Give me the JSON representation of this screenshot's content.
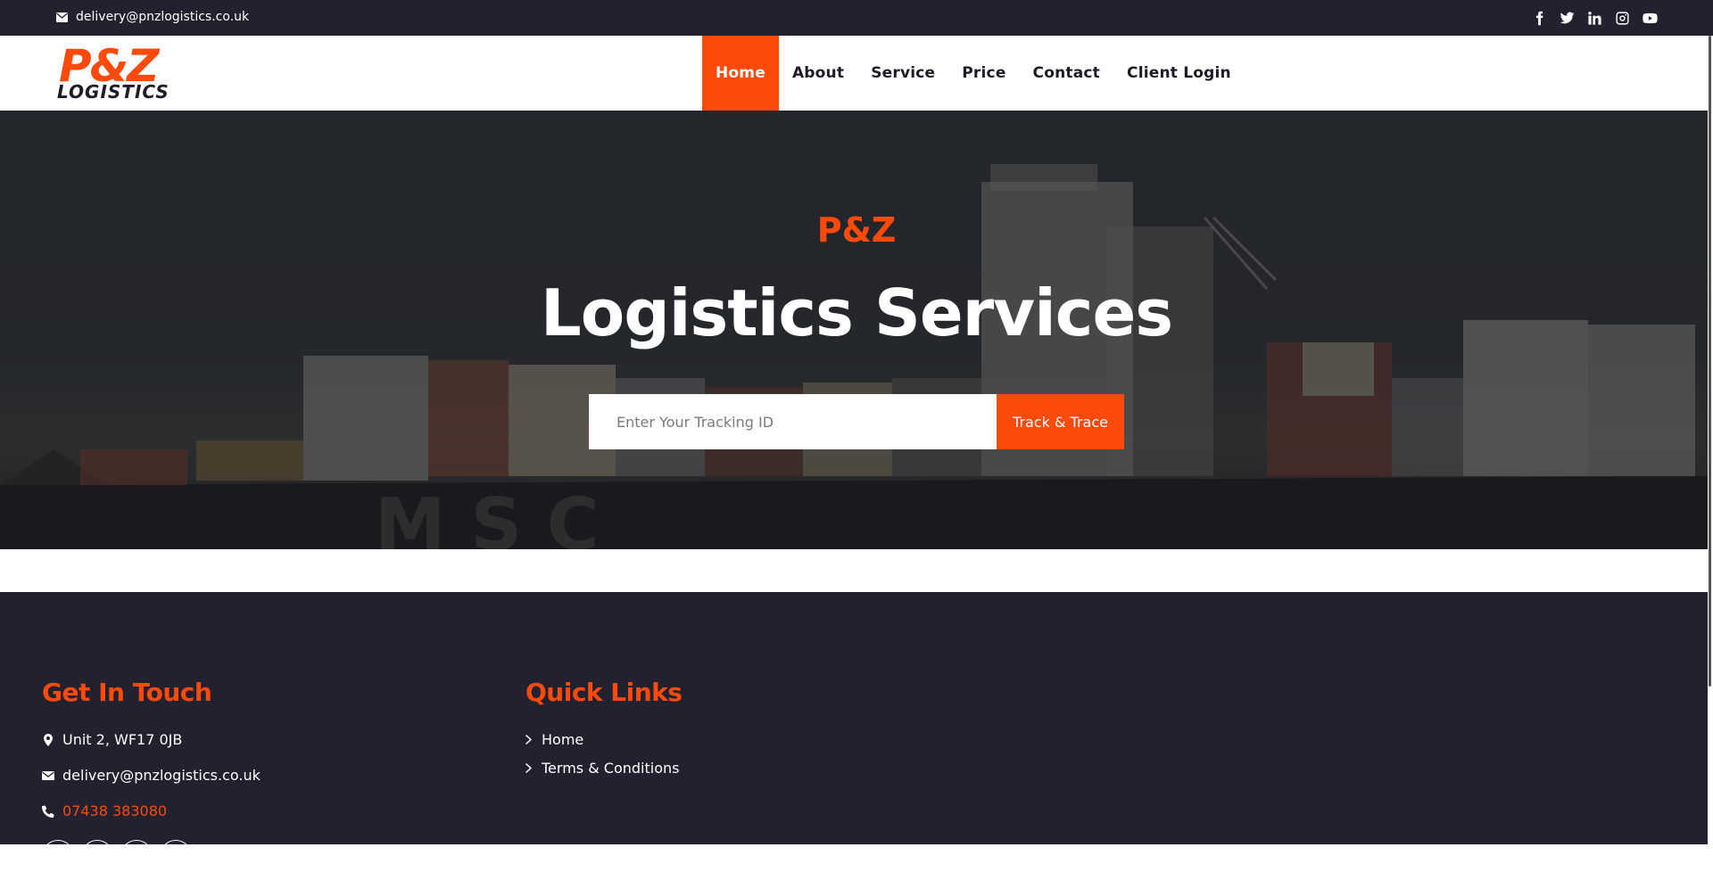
{
  "topbar": {
    "email": "delivery@pnzlogistics.co.uk",
    "social_icons": [
      "facebook-icon",
      "twitter-icon",
      "linkedin-icon",
      "instagram-icon",
      "youtube-icon"
    ]
  },
  "header": {
    "logo_main": "P&Z",
    "logo_sub": "LOGISTICS",
    "nav": [
      {
        "label": "Home",
        "active": true
      },
      {
        "label": "About",
        "active": false
      },
      {
        "label": "Service",
        "active": false
      },
      {
        "label": "Price",
        "active": false
      },
      {
        "label": "Contact",
        "active": false
      },
      {
        "label": "Client Login",
        "active": false
      }
    ]
  },
  "hero": {
    "brand": "P&Z",
    "title": "Logistics Services",
    "tracking_placeholder": "Enter Your Tracking ID",
    "tracking_value": "",
    "track_button": "Track & Trace"
  },
  "footer": {
    "contact_heading": "Get In Touch",
    "address": "Unit 2, WF17 0JB",
    "email": "delivery@pnzlogistics.co.uk",
    "phone": "07438 383080",
    "links_heading": "Quick Links",
    "links": [
      "Home",
      "Terms & Conditions"
    ]
  },
  "colors": {
    "accent": "#fb4a0c",
    "dark": "#212130"
  }
}
